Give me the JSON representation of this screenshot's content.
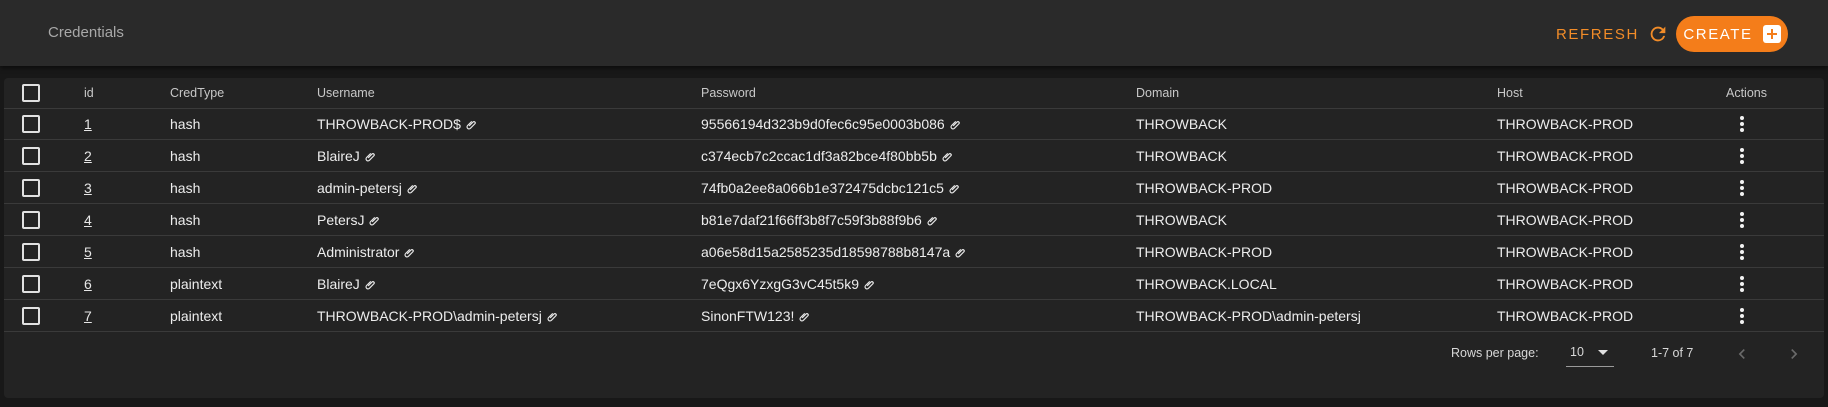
{
  "header": {
    "title": "Credentials",
    "refresh_label": "REFRESH",
    "create_label": "CREATE"
  },
  "colors": {
    "accent": "#f47d1a",
    "background": "#181818",
    "panel": "#232323",
    "appbar": "#2a2a2a"
  },
  "table": {
    "columns": [
      "id",
      "CredType",
      "Username",
      "Password",
      "Domain",
      "Host",
      "Actions"
    ],
    "rows": [
      {
        "id": "1",
        "credtype": "hash",
        "username": "THROWBACK-PROD$",
        "password": "95566194d323b9d0fec6c95e0003b086",
        "domain": "THROWBACK",
        "host": "THROWBACK-PROD"
      },
      {
        "id": "2",
        "credtype": "hash",
        "username": "BlaireJ",
        "password": "c374ecb7c2ccac1df3a82bce4f80bb5b",
        "domain": "THROWBACK",
        "host": "THROWBACK-PROD"
      },
      {
        "id": "3",
        "credtype": "hash",
        "username": "admin-petersj",
        "password": "74fb0a2ee8a066b1e372475dcbc121c5",
        "domain": "THROWBACK-PROD",
        "host": "THROWBACK-PROD"
      },
      {
        "id": "4",
        "credtype": "hash",
        "username": "PetersJ",
        "password": "b81e7daf21f66ff3b8f7c59f3b88f9b6",
        "domain": "THROWBACK",
        "host": "THROWBACK-PROD"
      },
      {
        "id": "5",
        "credtype": "hash",
        "username": "Administrator",
        "password": "a06e58d15a2585235d18598788b8147a",
        "domain": "THROWBACK-PROD",
        "host": "THROWBACK-PROD"
      },
      {
        "id": "6",
        "credtype": "plaintext",
        "username": "BlaireJ",
        "password": "7eQgx6YzxgG3vC45t5k9",
        "domain": "THROWBACK.LOCAL",
        "host": "THROWBACK-PROD"
      },
      {
        "id": "7",
        "credtype": "plaintext",
        "username": "THROWBACK-PROD\\admin-petersj",
        "password": "SinonFTW123!",
        "domain": "THROWBACK-PROD\\admin-petersj",
        "host": "THROWBACK-PROD"
      }
    ],
    "icons": {
      "copy": "paperclip-icon",
      "actions": "more-vert-icon"
    }
  },
  "pagination": {
    "rows_per_page_label": "Rows per page:",
    "rows_per_page_value": "10",
    "range": "1-7 of 7"
  }
}
